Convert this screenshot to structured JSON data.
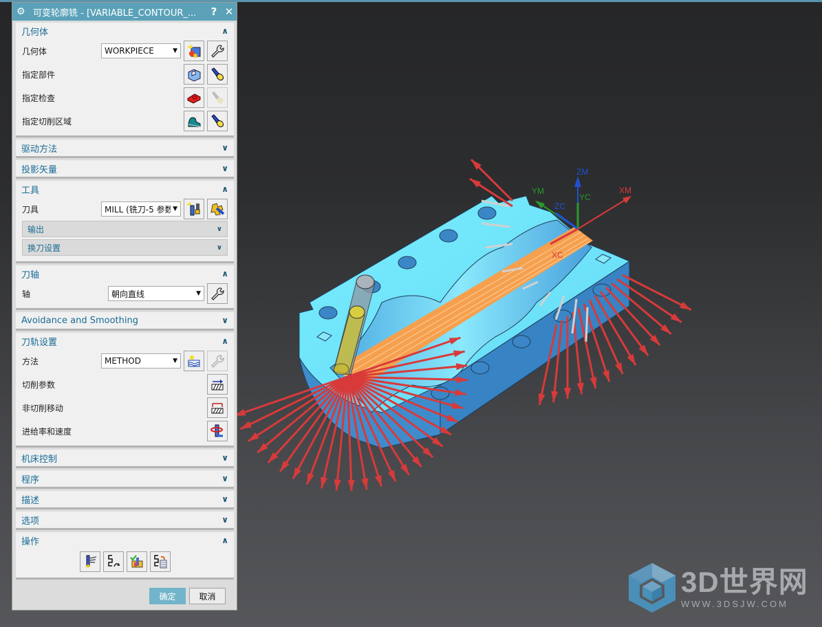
{
  "dialog": {
    "title": "可变轮廓铣 - [VARIABLE_CONTOUR_...",
    "help_label": "?",
    "close_label": "✕",
    "sections": {
      "geometry": {
        "header": "几何体",
        "state": "expanded",
        "geometry_label": "几何体",
        "geometry_value": "WORKPIECE",
        "specify_part_label": "指定部件",
        "specify_check_label": "指定检查",
        "specify_cut_area_label": "指定切削区域"
      },
      "drive_method": {
        "header": "驱动方法",
        "state": "collapsed"
      },
      "projection_vector": {
        "header": "投影矢量",
        "state": "collapsed"
      },
      "tool": {
        "header": "工具",
        "state": "expanded",
        "tool_label": "刀具",
        "tool_value": "MILL (铣刀-5 参数",
        "output_label": "输出",
        "tool_change_label": "换刀设置"
      },
      "tool_axis": {
        "header": "刀轴",
        "state": "expanded",
        "axis_label": "轴",
        "axis_value": "朝向直线"
      },
      "avoidance": {
        "header": "Avoidance and Smoothing",
        "state": "collapsed"
      },
      "path_settings": {
        "header": "刀轨设置",
        "state": "expanded",
        "method_label": "方法",
        "method_value": "METHOD",
        "cut_params_label": "切削参数",
        "non_cut_moves_label": "非切削移动",
        "feeds_speeds_label": "进给率和速度"
      },
      "machine_control": {
        "header": "机床控制",
        "state": "collapsed"
      },
      "program": {
        "header": "程序",
        "state": "collapsed"
      },
      "description": {
        "header": "描述",
        "state": "collapsed"
      },
      "options": {
        "header": "选项",
        "state": "collapsed"
      },
      "actions": {
        "header": "操作",
        "state": "expanded"
      }
    },
    "ok_label": "确定",
    "cancel_label": "取消"
  },
  "viewport": {
    "axis_labels": {
      "zm": "ZM",
      "ym": "YM",
      "yc": "YC",
      "zc": "ZC",
      "xm": "XM",
      "xc": "XC"
    },
    "colors": {
      "part": "#6fe3fb",
      "part_side": "#3f8fcf",
      "toolpath": "#f6a04e",
      "vector": "#d83a3a",
      "tool": "#c8c040"
    }
  },
  "watermark": {
    "title": "3D世界网",
    "url": "WWW.3DSJW.COM"
  },
  "icons": {
    "chevron_up": "∧",
    "chevron_down": "∨",
    "dropdown": "▼",
    "gear": "⚙"
  }
}
